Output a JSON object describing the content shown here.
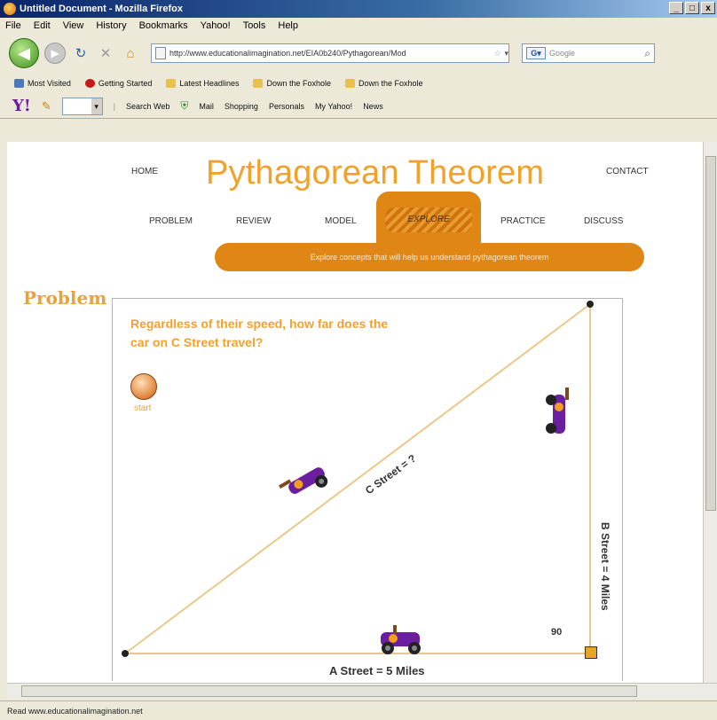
{
  "window": {
    "title": "Untitled Document - Mozilla Firefox",
    "controls": [
      "_",
      "□",
      "x"
    ]
  },
  "menu": [
    "File",
    "Edit",
    "View",
    "History",
    "Bookmarks",
    "Yahoo!",
    "Tools",
    "Help"
  ],
  "nav": {
    "url": "http://www.educationalimagination.net/EIA0b240/Pythagorean/Mod",
    "search_placeholder": "Google"
  },
  "bookmarks": [
    "Most Visited",
    "Getting Started",
    "Latest Headlines",
    "Down the Foxhole",
    "Down the Foxhole"
  ],
  "yahoo_toolbar": {
    "logo": "Y!",
    "items": [
      "Search Web",
      "Mail",
      "Shopping",
      "Personals",
      "My Yahoo!",
      "News"
    ]
  },
  "site": {
    "title": "Pythagorean Theorem",
    "home": "HOME",
    "contact": "CONTACT",
    "tabs": [
      "PROBLEM",
      "REVIEW",
      "MODEL",
      "EXPLORE",
      "PRACTICE",
      "DISCUSS"
    ],
    "active_tab": "EXPLORE",
    "banner": "Explore concepts that will help us understand pythagorean theorem",
    "section_heading": "Problem",
    "question": "Regardless of their speed, how far does the car on C Street travel?",
    "start_label": "start",
    "labels": {
      "a_street": "A Street = 5 Miles",
      "b_street": "B Street = 4 Miles",
      "c_street": "C Street = ?",
      "angle": "90"
    }
  },
  "status": "Read www.educationalimagination.net",
  "colors": {
    "accent_orange": "#e08614",
    "title_orange": "#f2a22b",
    "line_tan": "#e9c98a"
  }
}
